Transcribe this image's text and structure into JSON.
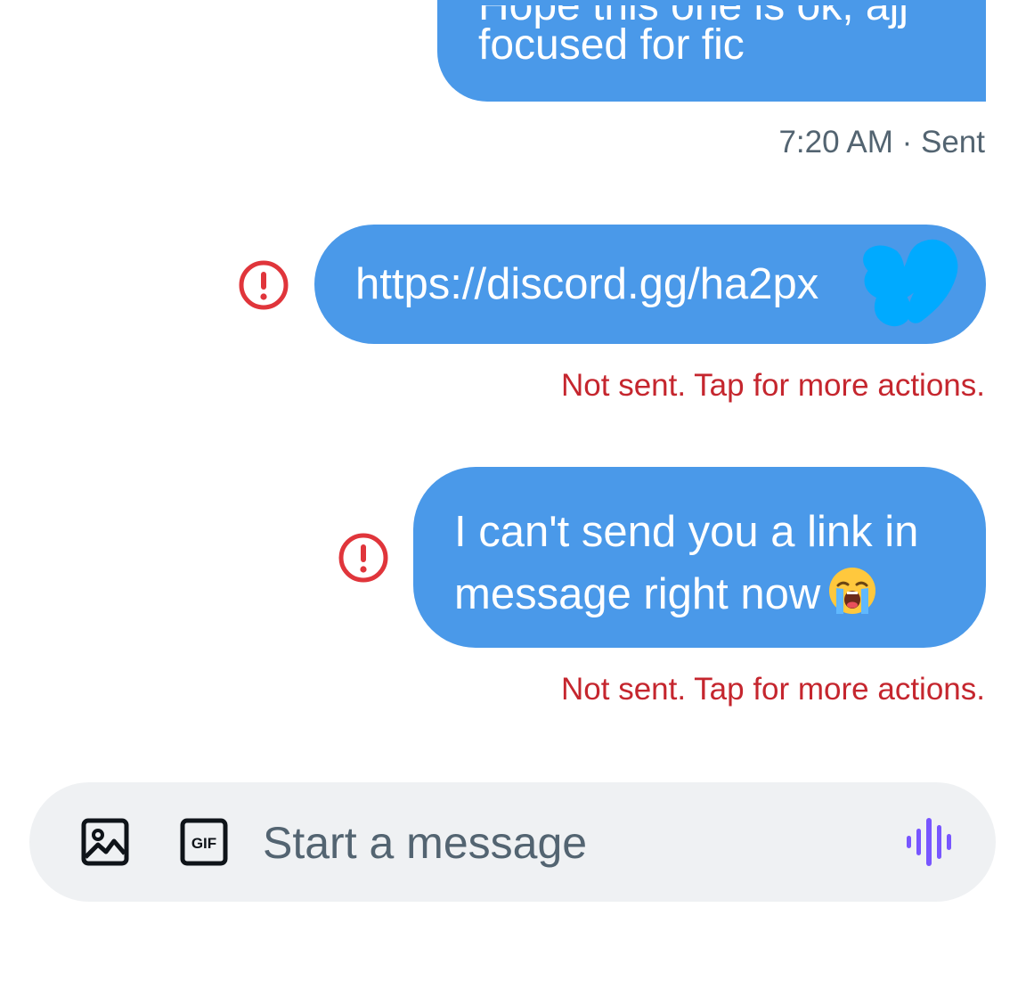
{
  "messages": [
    {
      "partial_line": "Hope this one is ok, ajj",
      "text_line": "focused for fic",
      "timestamp": "7:20 AM · Sent",
      "bubble_color": "#4a99e9"
    },
    {
      "text": "https://discord.gg/ha2px",
      "status": "Not sent. Tap for more actions.",
      "error_icon": "alert-circle-icon",
      "redaction_color": "#00a8ff"
    },
    {
      "lines": [
        "I can't send you a link in",
        "message right now"
      ],
      "emoji": "loudly-crying-face-emoji",
      "status": "Not sent. Tap for more actions.",
      "error_icon": "alert-circle-icon"
    }
  ],
  "composer": {
    "placeholder": "Start a message",
    "media_icon": "image-icon",
    "gif_icon": "gif-icon",
    "gif_label": "GIF",
    "voice_icon": "voice-waveform-icon",
    "voice_color": "#7856ff"
  },
  "colors": {
    "accent": "#4a99e9",
    "error": "#c5262e",
    "muted": "#536471",
    "composer_bg": "#eff1f3"
  }
}
